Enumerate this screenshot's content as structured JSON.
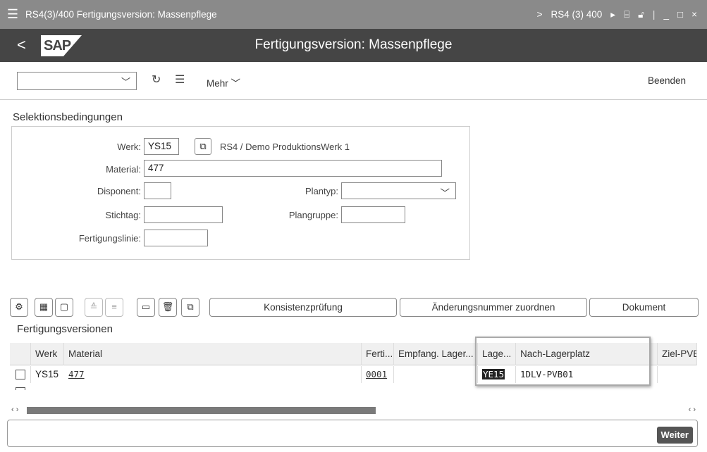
{
  "titlebar": {
    "menu_icon": "hamburger-icon",
    "title": "RS4(3)/400 Fertigungsversion: Massenpflege",
    "arrow": ">",
    "system": "RS4 (3) 400",
    "window_buttons": [
      "_",
      "□",
      "×"
    ]
  },
  "header": {
    "back": "<",
    "logo": "SAP",
    "title": "Fertigungsversion: Massenpflege"
  },
  "toolbar": {
    "dropdown_value": "",
    "mehr": "Mehr",
    "beenden": "Beenden"
  },
  "selection": {
    "title": "Selektionsbedingungen",
    "werk_label": "Werk:",
    "werk_value": "YS15",
    "werk_desc": "RS4 / Demo ProduktionsWerk 1",
    "material_label": "Material:",
    "material_value": "477",
    "disponent_label": "Disponent:",
    "disponent_value": "",
    "plantyp_label": "Plantyp:",
    "plantyp_value": "",
    "stichtag_label": "Stichtag:",
    "stichtag_value": "",
    "plangruppe_label": "Plangruppe:",
    "plangruppe_value": "",
    "fertigungslinie_label": "Fertigungslinie:",
    "fertigungslinie_value": ""
  },
  "table_toolbar": {
    "konsistenz": "Konsistenzprüfung",
    "aenderung": "Änderungsnummer zuordnen",
    "dokument": "Dokument"
  },
  "table": {
    "title": "Fertigungsversionen",
    "headers": [
      "Werk",
      "Material",
      "Ferti...",
      "Empfang. Lager...",
      "Lage...",
      "Nach-Lagerplatz",
      "Ziel-PVB"
    ],
    "rows": [
      {
        "werk": "YS15",
        "material": "477",
        "ferti": "0001",
        "empfang": "",
        "lager": "YE15",
        "nach": "1DLV-PVB01",
        "ziel": ""
      }
    ]
  },
  "footer": {
    "weiter": "Weiter"
  }
}
